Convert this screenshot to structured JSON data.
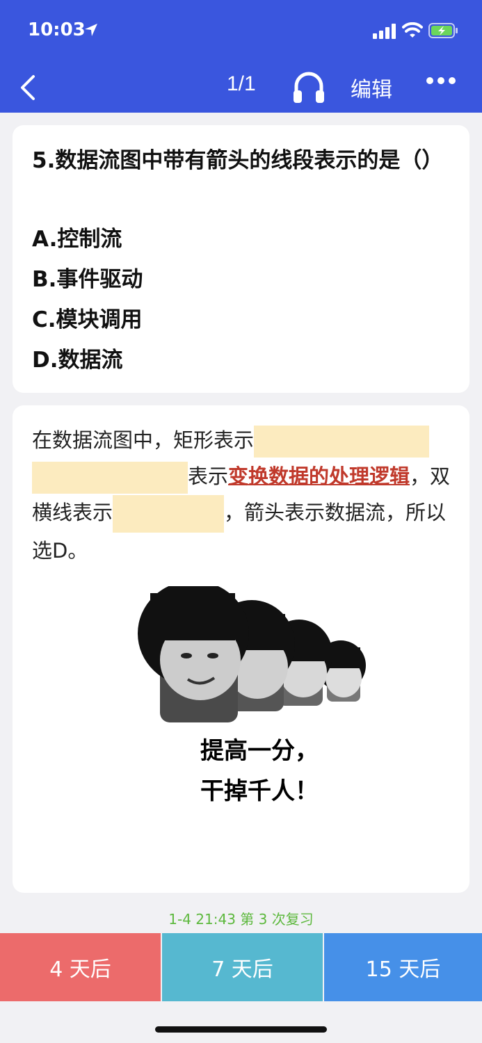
{
  "status_bar": {
    "time": "10:03"
  },
  "nav": {
    "counter": "1/1",
    "edit_label": "编辑"
  },
  "question": {
    "title": "5.数据流图中带有箭头的线段表示的是（）",
    "options": [
      "A.控制流",
      "B.事件驱动",
      "C.模块调用",
      "D.数据流"
    ]
  },
  "answer": {
    "part1": "在数据流图中，矩形表示",
    "part2": "表示",
    "highlight": "变换数据的处理逻辑",
    "part3": "，双横线表示",
    "part4": "，箭头表示数据流，所以选D。",
    "meme_line1": "提高一分，",
    "meme_line2": "干掉千人！"
  },
  "review": {
    "info": "1-4 21:43 第 3 次复习"
  },
  "buttons": {
    "b1": "4 天后",
    "b2": "7 天后",
    "b3": "15 天后"
  },
  "colors": {
    "header": "#3a56de",
    "blank": "#fcebbf",
    "red": "#c0392b",
    "green": "#5cb83c"
  }
}
